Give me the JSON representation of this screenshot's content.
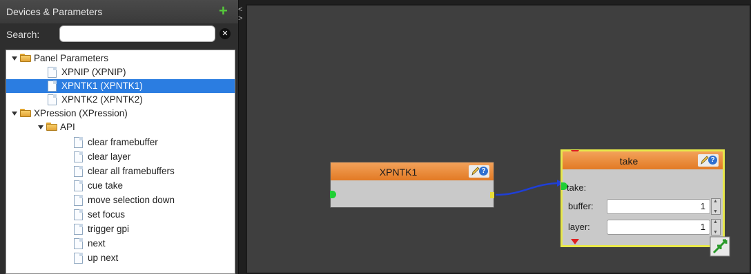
{
  "panel": {
    "title": "Devices & Parameters",
    "search_label": "Search:",
    "search_value": "",
    "add_icon": "plus-icon",
    "clear_icon": "clear-icon"
  },
  "tree": [
    {
      "label": "Panel Parameters",
      "type": "folder",
      "expanded": true
    },
    {
      "label": "XPNIP (XPNIP)",
      "type": "doc"
    },
    {
      "label": "XPNTK1 (XPNTK1)",
      "type": "doc",
      "selected": true
    },
    {
      "label": "XPNTK2 (XPNTK2)",
      "type": "doc"
    },
    {
      "label": "XPression (XPression)",
      "type": "folder",
      "expanded": true
    },
    {
      "label": "API",
      "type": "folder",
      "expanded": true
    },
    {
      "label": "clear framebuffer",
      "type": "doc"
    },
    {
      "label": "clear layer",
      "type": "doc"
    },
    {
      "label": "clear all framebuffers",
      "type": "doc"
    },
    {
      "label": "cue take",
      "type": "doc"
    },
    {
      "label": "move selection down",
      "type": "doc"
    },
    {
      "label": "set focus",
      "type": "doc"
    },
    {
      "label": "trigger gpi",
      "type": "doc"
    },
    {
      "label": "next",
      "type": "doc"
    },
    {
      "label": "up next",
      "type": "doc"
    }
  ],
  "canvas": {
    "source_block": {
      "title": "XPNTK1"
    },
    "take_block": {
      "title": "take",
      "params": [
        {
          "label": "take:"
        },
        {
          "label": "buffer:",
          "value": "1"
        },
        {
          "label": "layer:",
          "value": "1"
        }
      ]
    }
  },
  "colors": {
    "selection": "#2b7de1",
    "block_header": "#e8873a",
    "connector": "#1f3fd6",
    "port_in": "#1fcf34",
    "highlight_border": "#e8e84a"
  }
}
